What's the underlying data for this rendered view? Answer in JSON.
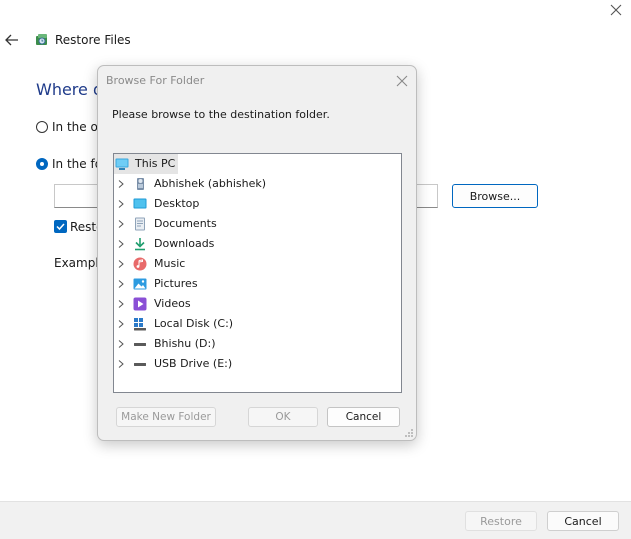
{
  "window": {
    "title": "Restore Files",
    "heading": "Where do",
    "option_original": "In the ori",
    "option_following": "In the fo",
    "browse_label": "Browse...",
    "restore_checkbox_label": "Resto",
    "example_label": "Example",
    "path_value": ""
  },
  "footer": {
    "restore_label": "Restore",
    "cancel_label": "Cancel"
  },
  "dialog": {
    "title": "Browse For Folder",
    "instruction": "Please browse to the destination folder.",
    "tree": [
      {
        "label": "This PC",
        "icon": "pc-icon"
      },
      {
        "label": "Abhishek (abhishek)",
        "icon": "user-folder-icon"
      },
      {
        "label": "Desktop",
        "icon": "desktop-icon"
      },
      {
        "label": "Documents",
        "icon": "documents-icon"
      },
      {
        "label": "Downloads",
        "icon": "downloads-icon"
      },
      {
        "label": "Music",
        "icon": "music-icon"
      },
      {
        "label": "Pictures",
        "icon": "pictures-icon"
      },
      {
        "label": "Videos",
        "icon": "videos-icon"
      },
      {
        "label": "Local Disk (C:)",
        "icon": "local-disk-icon"
      },
      {
        "label": "Bhishu (D:)",
        "icon": "drive-icon"
      },
      {
        "label": "USB Drive (E:)",
        "icon": "usb-drive-icon"
      }
    ],
    "make_new_folder_label": "Make New Folder",
    "ok_label": "OK",
    "cancel_label": "Cancel"
  },
  "colors": {
    "accent": "#0067c0",
    "heading": "#1f3b8a"
  }
}
